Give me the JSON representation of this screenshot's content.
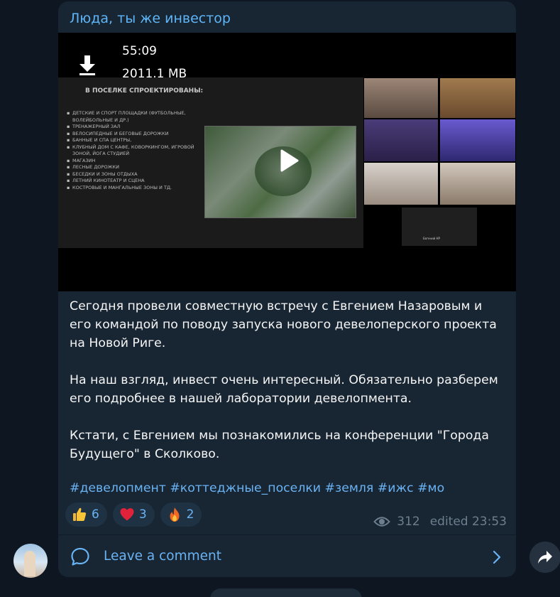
{
  "post": {
    "author": "Люда, ты же инвестор",
    "video": {
      "duration": "55:09",
      "size": "2011.1 MB",
      "slide_title": "В ПОСЕЛКЕ СПРОЕКТИРОВАНЫ:",
      "slide_items": [
        "ДЕТСКИЕ И СПОРТ ПЛОЩАДКИ (ФУТБОЛЬНЫЕ, ВОЛЕЙБОЛЬНЫЕ И ДР.)",
        "ТРЕНАЖЕРНЫЙ ЗАЛ",
        "ВЕЛОСИПЕДНЫЕ И БЕГОВЫЕ ДОРОЖКИ",
        "БАННЫЕ И СПА ЦЕНТРЫ,",
        "КЛУБНЫЙ ДОМ С КАФЕ, КОВОРКИНГОМ, ИГРОВОЙ ЗОНОЙ, ЙОГА СТУДИЕЙ",
        "МАГАЗИН",
        "ЛЕСНЫЕ ДОРОЖКИ",
        "БЕСЕДКИ И ЗОНЫ ОТДЫХА",
        "ЛЕТНИЙ КИНОТЕАТР И СЦЕНА",
        "КОСТРОВЫЕ И МАНГАЛЬНЫЕ ЗОНЫ И ТД."
      ],
      "participant_label": "Евгений НР"
    },
    "paragraphs": [
      "Сегодня провели совместную встречу с Евгением Назаровым и его командой по поводу запуска нового девелоперского проекта на Новой Риге.",
      "На наш взгляд, инвест очень  интересный. Обязательно разберем его подробнее в нашей лаборатории девелопмента.",
      "Кстати, с Евгением мы познакомились на конференции \"Города Будущего\" в Сколково."
    ],
    "hashtags": "#девелопмент #коттеджные_поселки #земля #ижс #мо",
    "reactions": [
      {
        "icon": "thumbs-up-icon",
        "count": "6"
      },
      {
        "icon": "heart-icon",
        "count": "3"
      },
      {
        "icon": "fire-icon",
        "count": "2"
      }
    ],
    "views": "312",
    "edited": "edited 23:53",
    "comment_label": "Leave a comment"
  },
  "colors": {
    "background": "#0e1621",
    "bubble": "#182533",
    "accent": "#6ab3f3",
    "author": "#5eb5f7",
    "muted": "#6d7f8f"
  }
}
